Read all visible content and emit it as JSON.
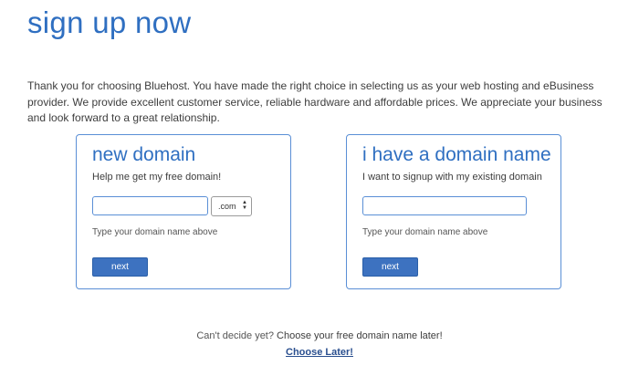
{
  "page": {
    "title": "sign up now",
    "intro": "Thank you for choosing Bluehost. You have made the right choice in selecting us as your web hosting and eBusiness provider. We provide excellent customer service, reliable hardware and affordable prices. We appreciate your business and look forward to a great relationship."
  },
  "new_domain": {
    "title": "new domain",
    "subtitle": "Help me get my free domain!",
    "input_value": "",
    "tld_selected": ".com",
    "helper": "Type your domain name above",
    "next_label": "next"
  },
  "existing_domain": {
    "title": "i have a domain name",
    "subtitle": "I want to signup with my existing domain",
    "input_value": "",
    "helper": "Type your domain name above",
    "next_label": "next"
  },
  "footer": {
    "undecided_prefix": "Can't decide yet?",
    "undecided_cta": "Choose your free domain name later!",
    "choose_later_label": "Choose Later!"
  },
  "colors": {
    "brand_blue": "#2f6fc1",
    "button_blue": "#3d72c0",
    "border_blue": "#5a8fd6"
  },
  "icons": {
    "select_arrows": "updown-chevron-icon"
  }
}
